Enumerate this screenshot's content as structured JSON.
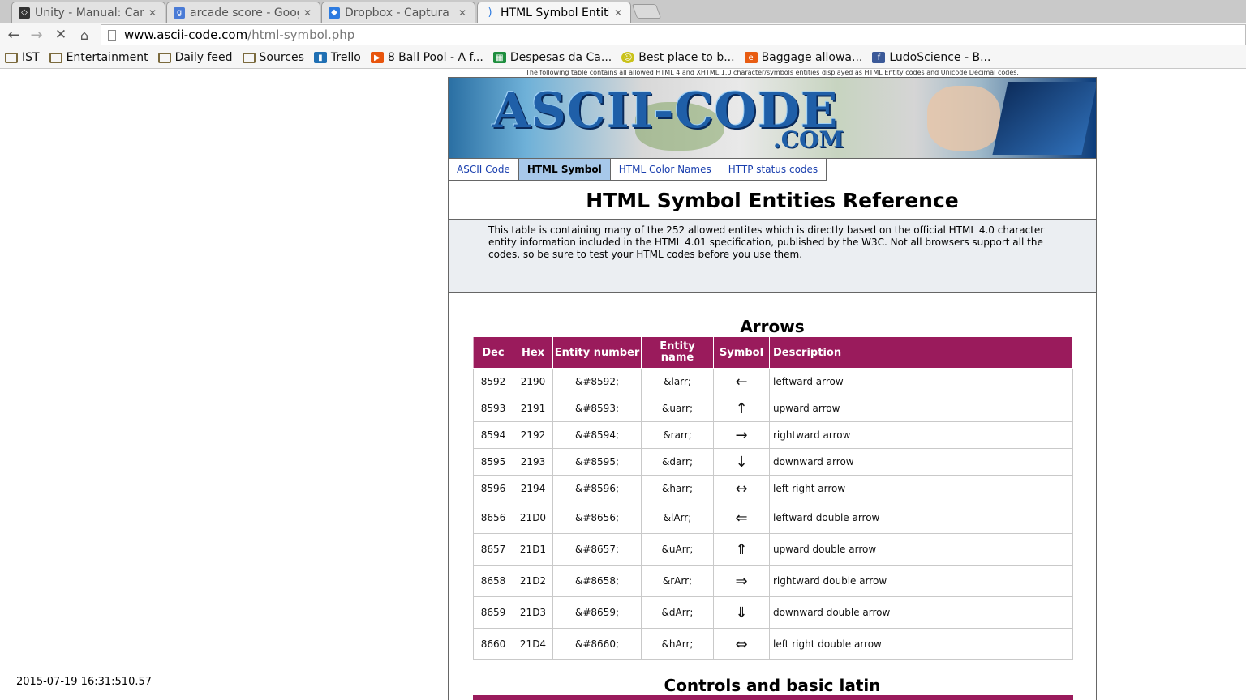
{
  "browser": {
    "tabs": [
      {
        "title": "Unity - Manual: Canv",
        "favicon": "unity-icon",
        "color": "#333333",
        "active": false
      },
      {
        "title": "arcade score - Googl",
        "favicon": "google-icon",
        "color": "#4a7bd6",
        "active": false
      },
      {
        "title": "Dropbox - Captura d",
        "favicon": "dropbox-icon",
        "color": "#2d7be0",
        "active": false
      },
      {
        "title": "HTML Symbol Entitie",
        "favicon": "loading-icon",
        "color": "#2d7be0",
        "active": true
      }
    ],
    "url_host": "www.ascii-code.com",
    "url_path": "/html-symbol.php",
    "bookmarks": [
      {
        "label": "IST",
        "icon": "folder-icon"
      },
      {
        "label": "Entertainment",
        "icon": "folder-icon"
      },
      {
        "label": "Daily feed",
        "icon": "folder-icon"
      },
      {
        "label": "Sources",
        "icon": "folder-icon"
      },
      {
        "label": "Trello",
        "icon": "trello-icon"
      },
      {
        "label": "8 Ball Pool - A f...",
        "icon": "play-icon"
      },
      {
        "label": "Despesas da Ca...",
        "icon": "sheets-icon"
      },
      {
        "label": "Best place to b...",
        "icon": "smiley-icon"
      },
      {
        "label": "Baggage allowa...",
        "icon": "e-icon"
      },
      {
        "label": "LudoScience - B...",
        "icon": "facebook-icon"
      }
    ]
  },
  "page": {
    "top_note": "The following table contains all allowed HTML 4 and XHTML 1.0 character/symbols entities displayed as HTML Entity codes and Unicode Decimal codes.",
    "logo_text": "ASCII-CODE",
    "logo_suffix": ".COM",
    "nav": [
      "ASCII Code",
      "HTML Symbol",
      "HTML Color Names",
      "HTTP status codes"
    ],
    "nav_active": 1,
    "title": "HTML Symbol Entities Reference",
    "intro": "This table is containing many of the 252 allowed entites which is directly based on the official HTML 4.0 character entity information included in the HTML 4.01 specification, published by the W3C. Not all browsers support all the codes, so be sure to test your HTML codes before you use them.",
    "section1_title": "Arrows",
    "section2_title": "Controls and basic latin",
    "headers": [
      "Dec",
      "Hex",
      "Entity number",
      "Entity name",
      "Symbol",
      "Description"
    ],
    "rows": [
      [
        "8592",
        "2190",
        "&#8592;",
        "&larr;",
        "←",
        "leftward arrow"
      ],
      [
        "8593",
        "2191",
        "&#8593;",
        "&uarr;",
        "↑",
        "upward arrow"
      ],
      [
        "8594",
        "2192",
        "&#8594;",
        "&rarr;",
        "→",
        "rightward arrow"
      ],
      [
        "8595",
        "2193",
        "&#8595;",
        "&darr;",
        "↓",
        "downward arrow"
      ],
      [
        "8596",
        "2194",
        "&#8596;",
        "&harr;",
        "↔",
        "left right arrow"
      ],
      [
        "8656",
        "21D0",
        "&#8656;",
        "&lArr;",
        "⇐",
        "leftward double arrow"
      ],
      [
        "8657",
        "21D1",
        "&#8657;",
        "&uArr;",
        "⇑",
        "upward double arrow"
      ],
      [
        "8658",
        "21D2",
        "&#8658;",
        "&rArr;",
        "⇒",
        "rightward double arrow"
      ],
      [
        "8659",
        "21D3",
        "&#8659;",
        "&dArr;",
        "⇓",
        "downward double arrow"
      ],
      [
        "8660",
        "21D4",
        "&#8660;",
        "&hArr;",
        "⇔",
        "left right double arrow"
      ]
    ]
  },
  "overlay": {
    "timestamp": "2015-07-19 16:31:510.57"
  },
  "colors": {
    "table_header": "#9a1b5c",
    "nav_active": "#a7c8ea",
    "link": "#1a3fae"
  }
}
